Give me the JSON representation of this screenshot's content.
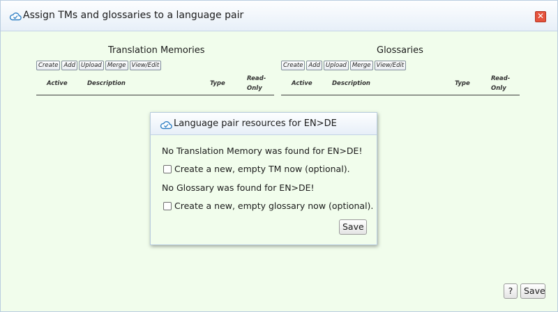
{
  "dialog": {
    "title": "Assign TMs and glossaries to a language pair",
    "close_label": "✕",
    "help_label": "?",
    "save_label": "Save"
  },
  "tm_section": {
    "title": "Translation Memories",
    "toolbar": [
      "Create",
      "Add",
      "Upload",
      "Merge",
      "View/Edit"
    ],
    "columns": {
      "active": "Active",
      "description": "Description",
      "type": "Type",
      "readonly_1": "Read-",
      "readonly_2": "Only"
    }
  },
  "gl_section": {
    "title": "Glossaries",
    "toolbar": [
      "Create",
      "Add",
      "Upload",
      "Merge",
      "View/Edit"
    ],
    "columns": {
      "active": "Active",
      "description": "Description",
      "type": "Type",
      "readonly_1": "Read-",
      "readonly_2": "Only"
    }
  },
  "popup": {
    "title": "Language pair resources for EN>DE",
    "tm_message": "No Translation Memory was found for EN>DE!",
    "tm_checkbox": "Create a new, empty TM now (optional).",
    "gl_message": "No Glossary was found for EN>DE!",
    "gl_checkbox": "Create a new, empty glossary now (optional).",
    "save_label": "Save"
  },
  "colors": {
    "panel_bg": "#f1fdec",
    "close_red": "#e5533d",
    "icon_blue": "#2f7fc4"
  }
}
